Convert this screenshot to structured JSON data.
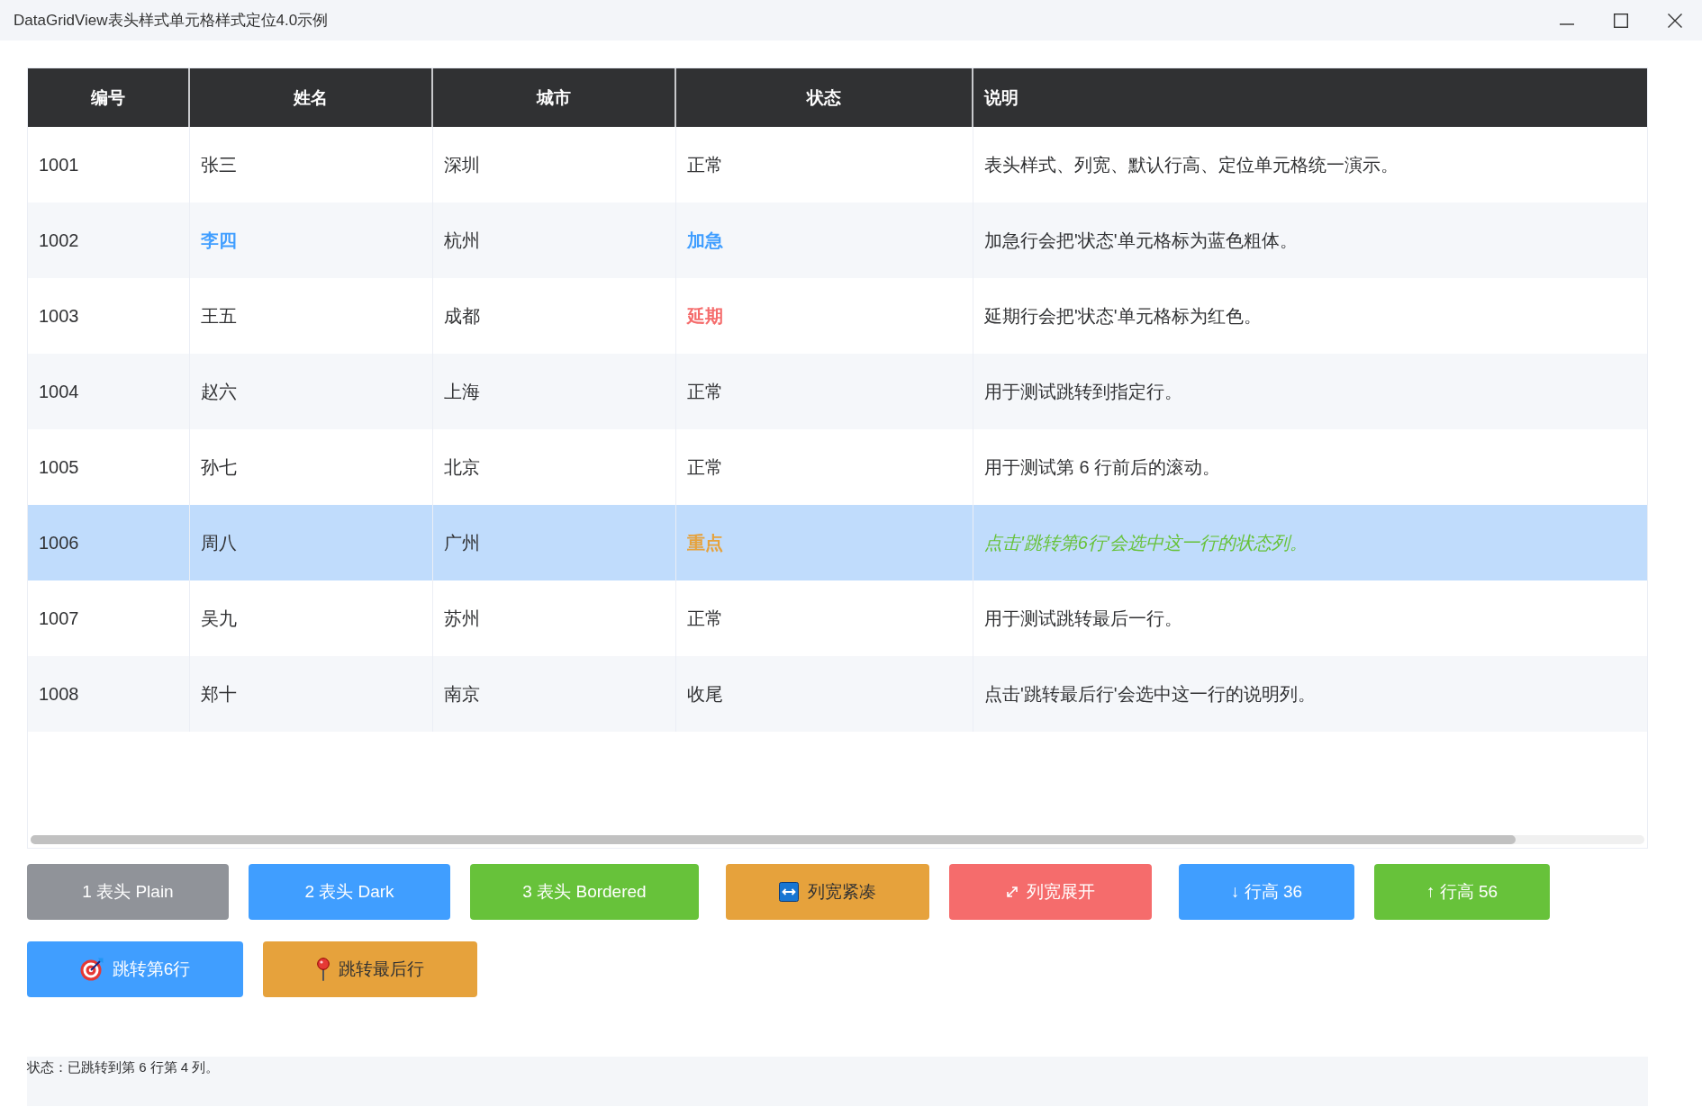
{
  "window": {
    "title": "DataGridView表头样式单元格样式定位4.0示例"
  },
  "table": {
    "columns": [
      "编号",
      "姓名",
      "城市",
      "状态",
      "说明"
    ],
    "rows": [
      {
        "selected": false,
        "cells": [
          {
            "text": "1001",
            "kind": "plain"
          },
          {
            "text": "张三",
            "kind": "plain"
          },
          {
            "text": "深圳",
            "kind": "plain"
          },
          {
            "text": "正常",
            "kind": "plain"
          },
          {
            "text": "表头样式、列宽、默认行高、定位单元格统一演示。",
            "kind": "plain"
          }
        ]
      },
      {
        "selected": false,
        "cells": [
          {
            "text": "1002",
            "kind": "plain"
          },
          {
            "text": "李四",
            "kind": "strong",
            "color": "#409eff"
          },
          {
            "text": "杭州",
            "kind": "plain"
          },
          {
            "text": "加急",
            "kind": "strong",
            "color": "#409eff"
          },
          {
            "text": "加急行会把'状态'单元格标为蓝色粗体。",
            "kind": "plain"
          }
        ]
      },
      {
        "selected": false,
        "cells": [
          {
            "text": "1003",
            "kind": "plain"
          },
          {
            "text": "王五",
            "kind": "plain"
          },
          {
            "text": "成都",
            "kind": "plain"
          },
          {
            "text": "延期",
            "kind": "strong",
            "color": "#f56c6c"
          },
          {
            "text": "延期行会把'状态'单元格标为红色。",
            "kind": "plain"
          }
        ]
      },
      {
        "selected": false,
        "cells": [
          {
            "text": "1004",
            "kind": "plain"
          },
          {
            "text": "赵六",
            "kind": "plain"
          },
          {
            "text": "上海",
            "kind": "plain"
          },
          {
            "text": "正常",
            "kind": "plain"
          },
          {
            "text": "用于测试跳转到指定行。",
            "kind": "plain"
          }
        ]
      },
      {
        "selected": false,
        "cells": [
          {
            "text": "1005",
            "kind": "plain"
          },
          {
            "text": "孙七",
            "kind": "plain"
          },
          {
            "text": "北京",
            "kind": "plain"
          },
          {
            "text": "正常",
            "kind": "plain"
          },
          {
            "text": "用于测试第 6 行前后的滚动。",
            "kind": "plain"
          }
        ]
      },
      {
        "selected": true,
        "cells": [
          {
            "text": "1006",
            "kind": "plain"
          },
          {
            "text": "周八",
            "kind": "plain"
          },
          {
            "text": "广州",
            "kind": "plain"
          },
          {
            "text": "重点",
            "kind": "strong",
            "color": "#e6a23c"
          },
          {
            "text": "点击'跳转第6行'会选中这一行的状态列。",
            "kind": "note",
            "color": "#67c23a"
          }
        ]
      },
      {
        "selected": false,
        "cells": [
          {
            "text": "1007",
            "kind": "plain"
          },
          {
            "text": "吴九",
            "kind": "plain"
          },
          {
            "text": "苏州",
            "kind": "plain"
          },
          {
            "text": "正常",
            "kind": "plain"
          },
          {
            "text": "用于测试跳转最后一行。",
            "kind": "plain"
          }
        ]
      },
      {
        "selected": false,
        "cells": [
          {
            "text": "1008",
            "kind": "plain"
          },
          {
            "text": "郑十",
            "kind": "plain"
          },
          {
            "text": "南京",
            "kind": "plain"
          },
          {
            "text": "收尾",
            "kind": "plain"
          },
          {
            "text": "点击'跳转最后行'会选中这一行的说明列。",
            "kind": "plain"
          }
        ]
      }
    ]
  },
  "buttons": [
    {
      "label": "1 表头 Plain",
      "kind": "header-style",
      "color": "#909399",
      "dark_text": false
    },
    {
      "label": "2 表头 Dark",
      "kind": "header-style",
      "color": "#409eff",
      "dark_text": false
    },
    {
      "label": "3 表头 Bordered",
      "kind": "header-style",
      "color": "#67c23a",
      "dark_text": false
    },
    {
      "label": "列宽紧凑",
      "kind": "compact-columns",
      "color": "#e6a23c",
      "dark_text": true
    },
    {
      "label": "列宽展开",
      "kind": "expand-columns",
      "color": "#f56c6c",
      "dark_text": false
    },
    {
      "label": "↓ 行高 36",
      "kind": "row-height",
      "color": "#409eff",
      "dark_text": false
    },
    {
      "label": "↑ 行高 56",
      "kind": "row-height",
      "color": "#67c23a",
      "dark_text": false
    },
    {
      "label": "跳转第6行",
      "kind": "jump-row",
      "color": "#409eff",
      "dark_text": false
    },
    {
      "label": "跳转最后行",
      "kind": "jump-last",
      "color": "#e6a23c",
      "dark_text": true
    }
  ],
  "status_bar": {
    "text": "状态：已跳转到第 6 行第 4 列。"
  }
}
